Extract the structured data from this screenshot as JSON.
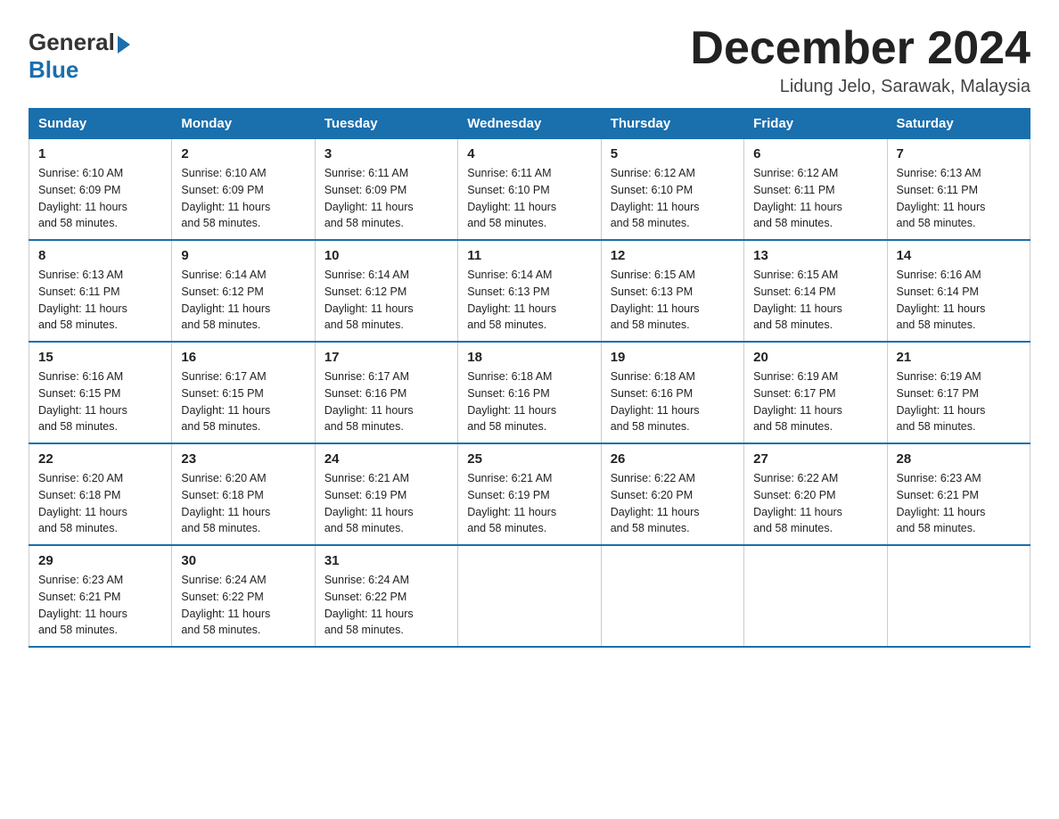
{
  "header": {
    "logo_general": "General",
    "logo_blue": "Blue",
    "month_title": "December 2024",
    "location": "Lidung Jelo, Sarawak, Malaysia"
  },
  "days_of_week": [
    "Sunday",
    "Monday",
    "Tuesday",
    "Wednesday",
    "Thursday",
    "Friday",
    "Saturday"
  ],
  "weeks": [
    [
      {
        "day": "1",
        "sunrise": "6:10 AM",
        "sunset": "6:09 PM",
        "daylight": "11 hours and 58 minutes."
      },
      {
        "day": "2",
        "sunrise": "6:10 AM",
        "sunset": "6:09 PM",
        "daylight": "11 hours and 58 minutes."
      },
      {
        "day": "3",
        "sunrise": "6:11 AM",
        "sunset": "6:09 PM",
        "daylight": "11 hours and 58 minutes."
      },
      {
        "day": "4",
        "sunrise": "6:11 AM",
        "sunset": "6:10 PM",
        "daylight": "11 hours and 58 minutes."
      },
      {
        "day": "5",
        "sunrise": "6:12 AM",
        "sunset": "6:10 PM",
        "daylight": "11 hours and 58 minutes."
      },
      {
        "day": "6",
        "sunrise": "6:12 AM",
        "sunset": "6:11 PM",
        "daylight": "11 hours and 58 minutes."
      },
      {
        "day": "7",
        "sunrise": "6:13 AM",
        "sunset": "6:11 PM",
        "daylight": "11 hours and 58 minutes."
      }
    ],
    [
      {
        "day": "8",
        "sunrise": "6:13 AM",
        "sunset": "6:11 PM",
        "daylight": "11 hours and 58 minutes."
      },
      {
        "day": "9",
        "sunrise": "6:14 AM",
        "sunset": "6:12 PM",
        "daylight": "11 hours and 58 minutes."
      },
      {
        "day": "10",
        "sunrise": "6:14 AM",
        "sunset": "6:12 PM",
        "daylight": "11 hours and 58 minutes."
      },
      {
        "day": "11",
        "sunrise": "6:14 AM",
        "sunset": "6:13 PM",
        "daylight": "11 hours and 58 minutes."
      },
      {
        "day": "12",
        "sunrise": "6:15 AM",
        "sunset": "6:13 PM",
        "daylight": "11 hours and 58 minutes."
      },
      {
        "day": "13",
        "sunrise": "6:15 AM",
        "sunset": "6:14 PM",
        "daylight": "11 hours and 58 minutes."
      },
      {
        "day": "14",
        "sunrise": "6:16 AM",
        "sunset": "6:14 PM",
        "daylight": "11 hours and 58 minutes."
      }
    ],
    [
      {
        "day": "15",
        "sunrise": "6:16 AM",
        "sunset": "6:15 PM",
        "daylight": "11 hours and 58 minutes."
      },
      {
        "day": "16",
        "sunrise": "6:17 AM",
        "sunset": "6:15 PM",
        "daylight": "11 hours and 58 minutes."
      },
      {
        "day": "17",
        "sunrise": "6:17 AM",
        "sunset": "6:16 PM",
        "daylight": "11 hours and 58 minutes."
      },
      {
        "day": "18",
        "sunrise": "6:18 AM",
        "sunset": "6:16 PM",
        "daylight": "11 hours and 58 minutes."
      },
      {
        "day": "19",
        "sunrise": "6:18 AM",
        "sunset": "6:16 PM",
        "daylight": "11 hours and 58 minutes."
      },
      {
        "day": "20",
        "sunrise": "6:19 AM",
        "sunset": "6:17 PM",
        "daylight": "11 hours and 58 minutes."
      },
      {
        "day": "21",
        "sunrise": "6:19 AM",
        "sunset": "6:17 PM",
        "daylight": "11 hours and 58 minutes."
      }
    ],
    [
      {
        "day": "22",
        "sunrise": "6:20 AM",
        "sunset": "6:18 PM",
        "daylight": "11 hours and 58 minutes."
      },
      {
        "day": "23",
        "sunrise": "6:20 AM",
        "sunset": "6:18 PM",
        "daylight": "11 hours and 58 minutes."
      },
      {
        "day": "24",
        "sunrise": "6:21 AM",
        "sunset": "6:19 PM",
        "daylight": "11 hours and 58 minutes."
      },
      {
        "day": "25",
        "sunrise": "6:21 AM",
        "sunset": "6:19 PM",
        "daylight": "11 hours and 58 minutes."
      },
      {
        "day": "26",
        "sunrise": "6:22 AM",
        "sunset": "6:20 PM",
        "daylight": "11 hours and 58 minutes."
      },
      {
        "day": "27",
        "sunrise": "6:22 AM",
        "sunset": "6:20 PM",
        "daylight": "11 hours and 58 minutes."
      },
      {
        "day": "28",
        "sunrise": "6:23 AM",
        "sunset": "6:21 PM",
        "daylight": "11 hours and 58 minutes."
      }
    ],
    [
      {
        "day": "29",
        "sunrise": "6:23 AM",
        "sunset": "6:21 PM",
        "daylight": "11 hours and 58 minutes."
      },
      {
        "day": "30",
        "sunrise": "6:24 AM",
        "sunset": "6:22 PM",
        "daylight": "11 hours and 58 minutes."
      },
      {
        "day": "31",
        "sunrise": "6:24 AM",
        "sunset": "6:22 PM",
        "daylight": "11 hours and 58 minutes."
      },
      null,
      null,
      null,
      null
    ]
  ],
  "labels": {
    "sunrise": "Sunrise:",
    "sunset": "Sunset:",
    "daylight": "Daylight:"
  }
}
